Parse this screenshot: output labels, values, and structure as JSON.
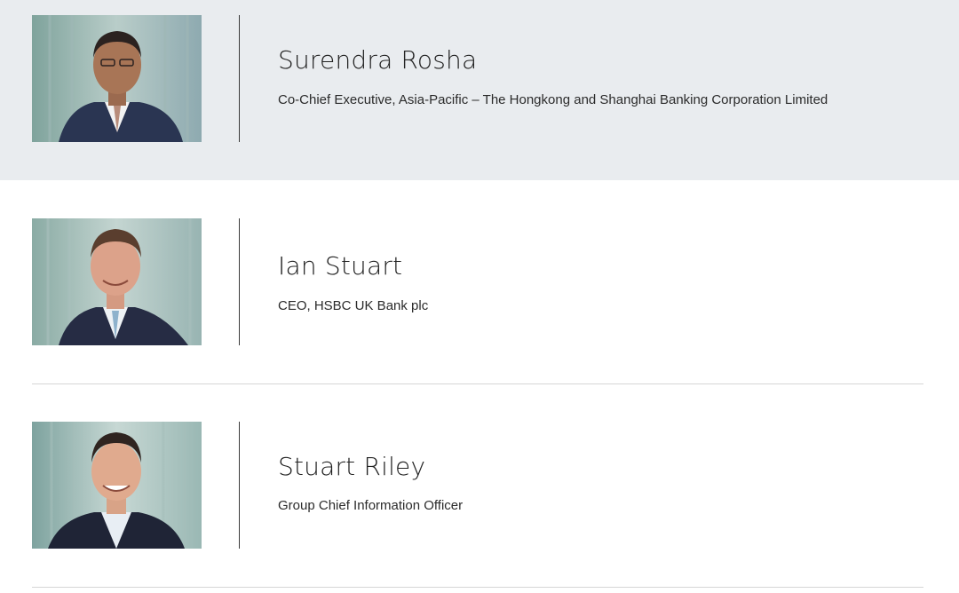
{
  "people": [
    {
      "name": "Surendra Rosha",
      "title": "Co-Chief Executive, Asia-Pacific – The Hongkong and Shanghai Banking Corporation Limited",
      "photo_icon": "portrait-photo"
    },
    {
      "name": "Ian Stuart",
      "title": "CEO, HSBC UK Bank plc",
      "photo_icon": "portrait-photo"
    },
    {
      "name": "Stuart Riley",
      "title": "Group Chief Information Officer",
      "photo_icon": "portrait-photo"
    }
  ],
  "colors": {
    "highlight_row": "#e9ecef",
    "divider": "#d6d6d6",
    "text": "#222222"
  }
}
